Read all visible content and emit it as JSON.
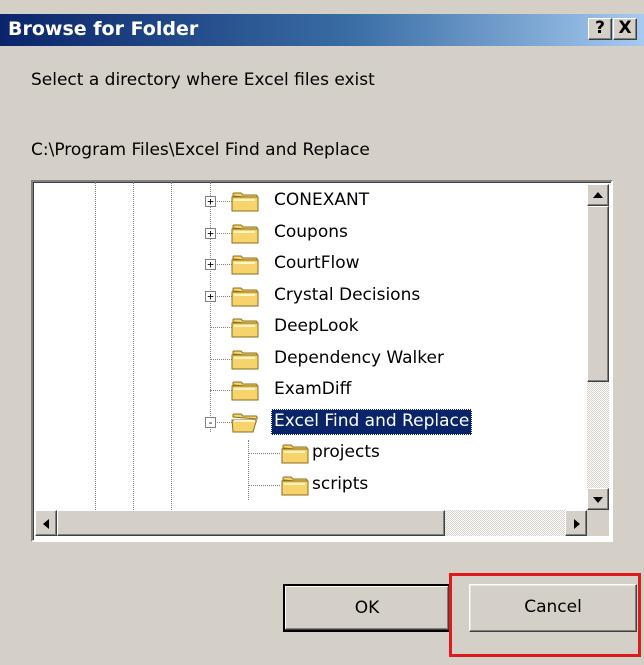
{
  "window": {
    "title": "Browse for Folder",
    "help_label": "?",
    "close_label": "X"
  },
  "instruction": "Select a directory where Excel files exist",
  "current_path": "C:\\Program Files\\Excel Find and Replace",
  "tree": {
    "items": [
      {
        "label": "CONEXANT",
        "expander": "+",
        "selected": false
      },
      {
        "label": "Coupons",
        "expander": "+",
        "selected": false
      },
      {
        "label": "CourtFlow",
        "expander": "+",
        "selected": false
      },
      {
        "label": "Crystal Decisions",
        "expander": "+",
        "selected": false
      },
      {
        "label": "DeepLook",
        "expander": "",
        "selected": false
      },
      {
        "label": "Dependency Walker",
        "expander": "",
        "selected": false
      },
      {
        "label": "ExamDiff",
        "expander": "",
        "selected": false
      },
      {
        "label": "Excel Find and Replace",
        "expander": "-",
        "selected": true
      },
      {
        "label": "projects",
        "expander": "",
        "selected": false
      },
      {
        "label": "scripts",
        "expander": "",
        "selected": false
      }
    ]
  },
  "buttons": {
    "ok_label": "OK",
    "cancel_label": "Cancel"
  },
  "colors": {
    "titlebar_start": "#0a246a",
    "titlebar_end": "#a6caf0",
    "selection": "#0a246a",
    "highlight": "#e0191b",
    "folder": "#f6d36b"
  },
  "icons": [
    "folder-icon",
    "expand-icon",
    "collapse-icon",
    "help-icon",
    "close-icon",
    "scroll-arrow-up-icon",
    "scroll-arrow-down-icon",
    "scroll-arrow-left-icon",
    "scroll-arrow-right-icon"
  ]
}
